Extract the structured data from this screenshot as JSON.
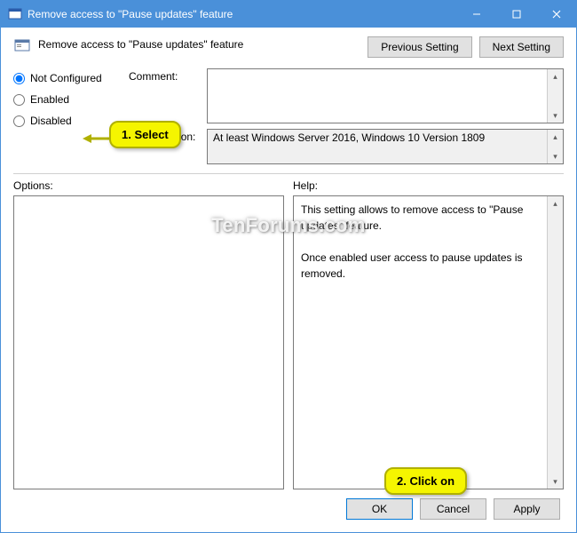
{
  "titlebar": {
    "title": "Remove access to \"Pause updates\" feature"
  },
  "header": {
    "policy_title": "Remove access to \"Pause updates\" feature",
    "prev_btn": "Previous Setting",
    "next_btn": "Next Setting"
  },
  "radios": {
    "not_configured": "Not Configured",
    "enabled": "Enabled",
    "disabled": "Disabled"
  },
  "labels": {
    "comment": "Comment:",
    "supported": "Supported on:",
    "options": "Options:",
    "help": "Help:"
  },
  "fields": {
    "comment_value": "",
    "supported_value": "At least Windows Server 2016, Windows 10 Version 1809",
    "options_value": "",
    "help_value": "This setting allows to remove access to \"Pause updates\" feature.\n\nOnce enabled user access to pause updates is removed."
  },
  "buttons": {
    "ok": "OK",
    "cancel": "Cancel",
    "apply": "Apply"
  },
  "callouts": {
    "c1": "1. Select",
    "c2": "2. Click on"
  },
  "watermark": "TenForums.com"
}
